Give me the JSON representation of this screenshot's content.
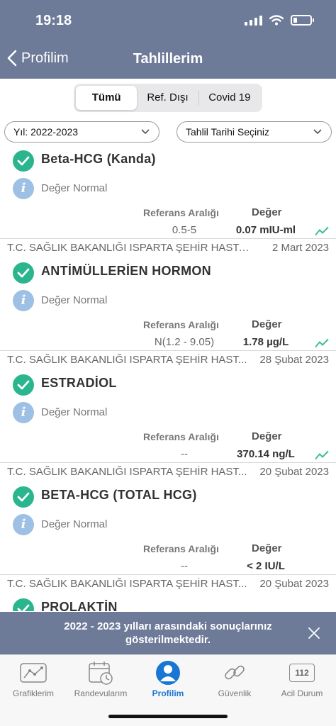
{
  "status_bar": {
    "time": "19:18"
  },
  "nav": {
    "back_label": "Profilim",
    "title": "Tahlillerim"
  },
  "segments": [
    {
      "label": "Tümü",
      "active": true
    },
    {
      "label": "Ref. Dışı",
      "active": false
    },
    {
      "label": "Covid 19",
      "active": false
    }
  ],
  "filters": {
    "year_label": "Yıl: 2022-2023",
    "date_label": "Tahlil Tarihi Seçiniz"
  },
  "results": [
    {
      "hospital": "",
      "date": "",
      "test": "Beta-HCG (Kanda)",
      "status": "Değer Normal",
      "ref_label": "Referans Aralığı",
      "value_label": "Değer",
      "range": "0.5-5",
      "value": "0.07 mIU-ml",
      "trend_icon": true
    },
    {
      "hospital": "T.C. SAĞLIK BAKANLIĞI ISPARTA ŞEHİR HASTAN...",
      "date": "2 Mart 2023",
      "test": "ANTİMÜLLERİEN HORMON",
      "status": "Değer Normal",
      "ref_label": "Referans Aralığı",
      "value_label": "Değer",
      "range": "N(1.2 - 9.05)",
      "value": "1.78 µg/L",
      "trend_icon": true
    },
    {
      "hospital": "T.C. SAĞLIK BAKANLIĞI ISPARTA ŞEHİR HAST...",
      "date": "28 Şubat 2023",
      "test": "ESTRADİOL",
      "status": "Değer Normal",
      "ref_label": "Referans Aralığı",
      "value_label": "Değer",
      "range": "--",
      "value": "370.14 ng/L",
      "trend_icon": true
    },
    {
      "hospital": "T.C. SAĞLIK BAKANLIĞI ISPARTA ŞEHİR HAST...",
      "date": "20 Şubat 2023",
      "test": "BETA-HCG (TOTAL HCG)",
      "status": "Değer Normal",
      "ref_label": "Referans Aralığı",
      "value_label": "Değer",
      "range": "--",
      "value": "< 2 IU/L",
      "trend_icon": false
    },
    {
      "hospital": "T.C. SAĞLIK BAKANLIĞI ISPARTA ŞEHİR HAST...",
      "date": "20 Şubat 2023",
      "test": "PROLAKTİN",
      "status": "",
      "ref_label": "",
      "value_label": "",
      "range": "",
      "value": "",
      "trend_icon": false
    }
  ],
  "banner": {
    "text": "2022 - 2023 yılları arasındaki sonuçlarınız gösterilmektedir."
  },
  "tabbar": [
    {
      "label": "Grafiklerim",
      "icon": "chart-icon",
      "active": false
    },
    {
      "label": "Randevularım",
      "icon": "calendar-icon",
      "active": false
    },
    {
      "label": "Profilim",
      "icon": "profile-icon",
      "active": true
    },
    {
      "label": "Güvenlik",
      "icon": "link-icon",
      "active": false
    },
    {
      "label": "Acil Durum",
      "icon": "emergency-112-icon",
      "active": false,
      "badge": "112"
    }
  ],
  "colors": {
    "header_bg": "#6d7a98",
    "check_green": "#2bb58e",
    "info_blue": "#9dc0e4",
    "active_tab": "#1976d2",
    "trend_green": "#3bbf8f"
  }
}
